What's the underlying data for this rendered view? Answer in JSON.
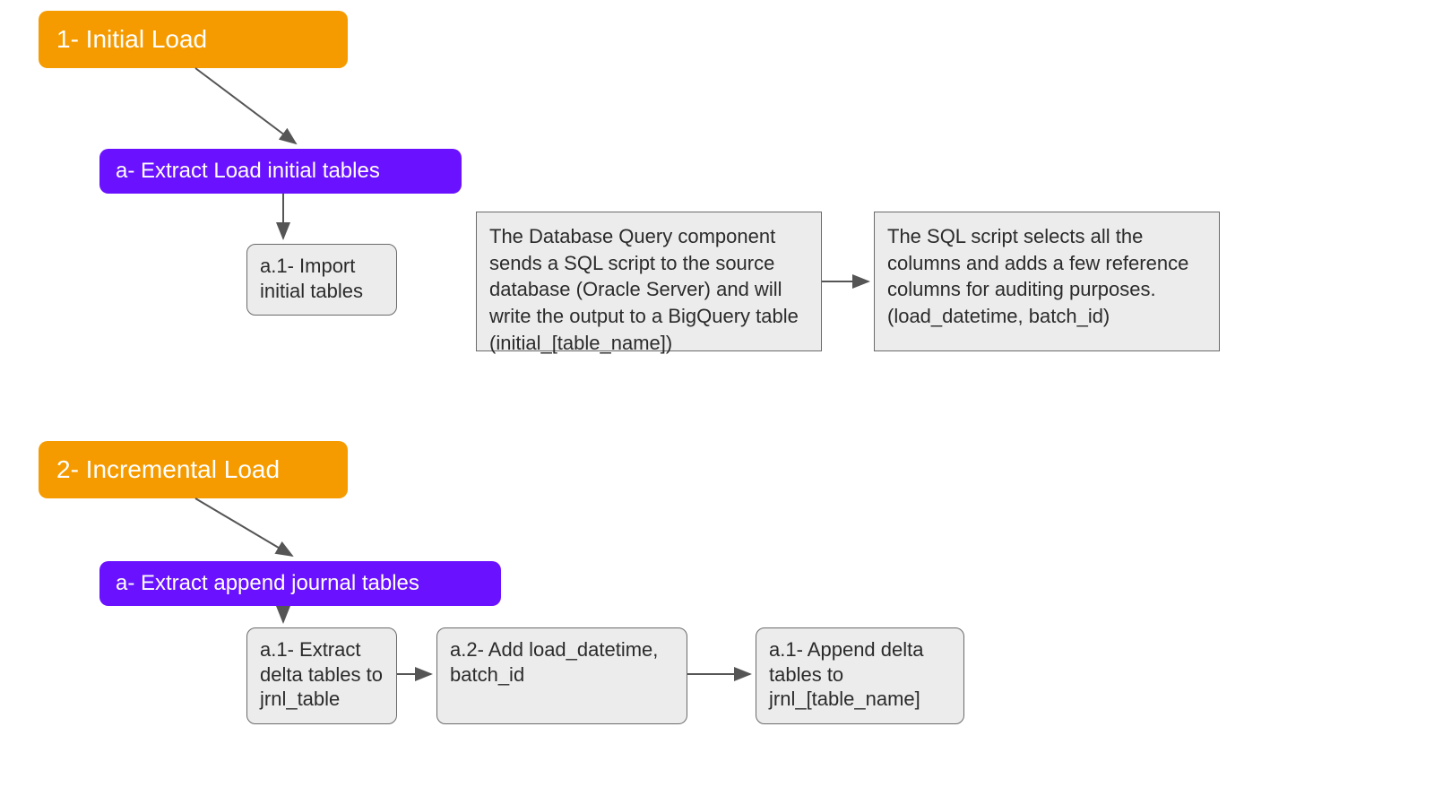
{
  "nodes": {
    "n1": "1- Initial Load",
    "n2": "a- Extract Load initial tables",
    "n3": "a.1- Import initial tables",
    "n4": "The Database Query component sends a SQL script to the source database (Oracle Server) and will write the output to a BigQuery table (initial_[table_name])",
    "n5": "The SQL script selects all the columns and adds a few reference columns for auditing purposes. (load_datetime, batch_id)",
    "n6": "2- Incremental Load",
    "n7": "a- Extract append journal tables",
    "n8": "a.1- Extract delta tables to jrnl_table",
    "n9": "a.2- Add load_datetime, batch_id",
    "n10": "a.1- Append delta tables to jrnl_[table_name]"
  },
  "colors": {
    "orange": "#f59b00",
    "purple": "#6a11ff",
    "grayFill": "#ececec",
    "grayStroke": "#6b6b6b",
    "arrow": "#555555"
  }
}
